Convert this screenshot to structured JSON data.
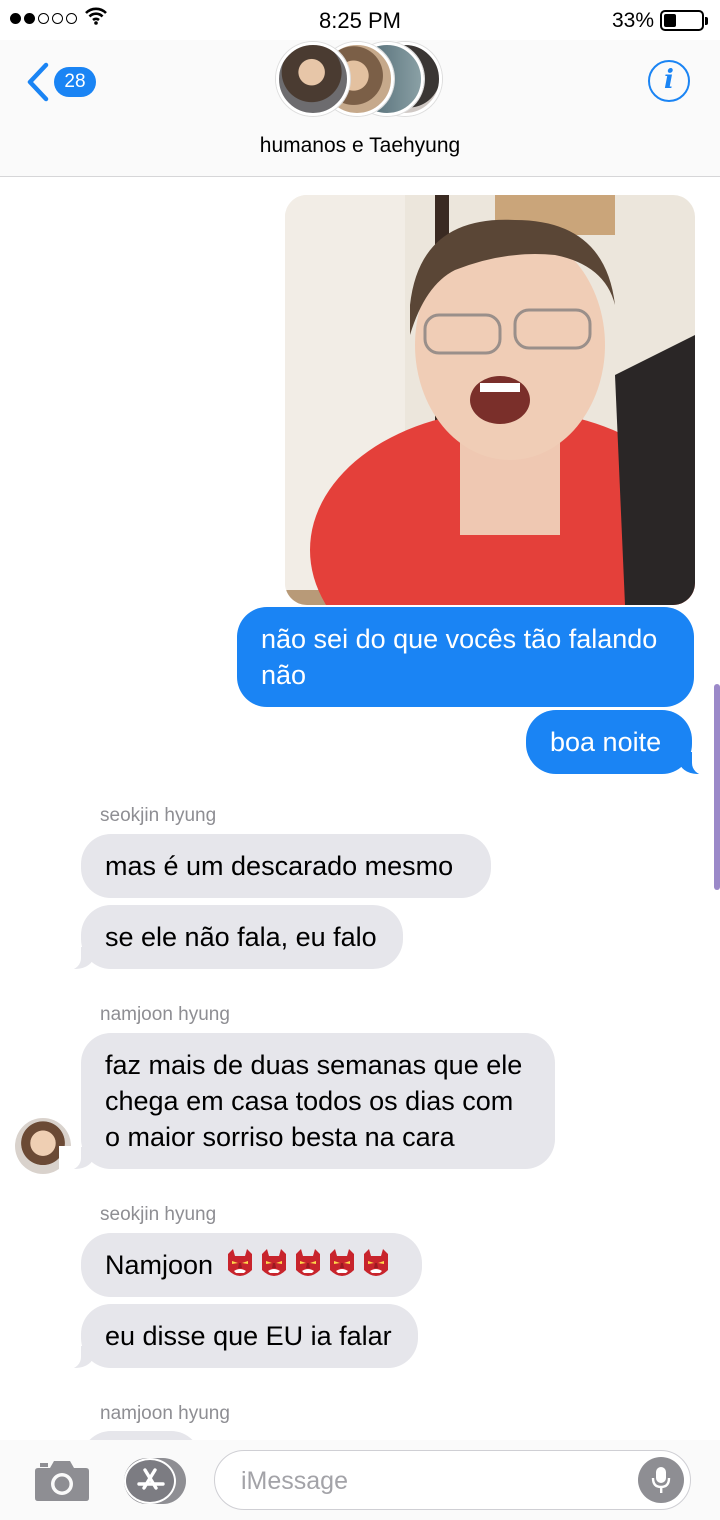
{
  "status_bar": {
    "time": "8:25 PM",
    "battery": "33%",
    "battery_level": 0.33,
    "signal_bars_filled": 2,
    "signal_bars_total": 5
  },
  "header": {
    "back_count": "28",
    "group_name": "humanos e Taehyung",
    "info_icon": "info-icon",
    "accent_color": "#1a84f4"
  },
  "messages": {
    "photo_icon": "photo-attachment",
    "outgoing_1": "não sei do que vocês tão falando não",
    "outgoing_2": "boa noite",
    "sender_1": "seokjin hyung",
    "incoming_1": "mas é um descarado mesmo",
    "incoming_2": "se ele não fala, eu falo",
    "sender_2": "namjoon hyung",
    "incoming_3": "faz mais de duas semanas que ele chega em casa todos os dias com o maior sorriso besta na cara",
    "sender_3": "seokjin hyung",
    "incoming_4_text": "Namjoon",
    "incoming_4_emoji_count": 5,
    "incoming_4_emoji": "goblin-mask-emoji",
    "incoming_5": "eu disse que EU ia falar",
    "sender_4": "namjoon hyung"
  },
  "input_bar": {
    "placeholder": "iMessage",
    "camera_icon": "camera-icon",
    "appstore_icon": "app-store-icon",
    "mic_icon": "microphone-icon"
  }
}
